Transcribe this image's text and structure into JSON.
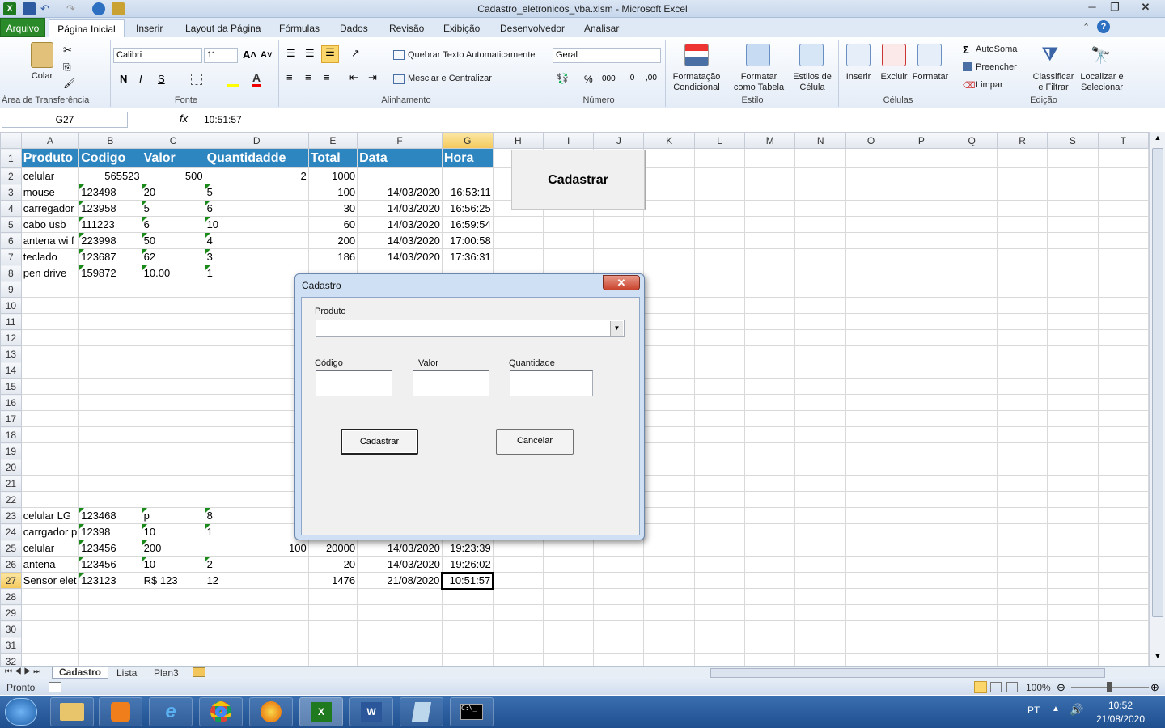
{
  "window": {
    "title": "Cadastro_eletronicos_vba.xlsm - Microsoft Excel"
  },
  "ribbon": {
    "tabs": [
      "Arquivo",
      "Página Inicial",
      "Inserir",
      "Layout da Página",
      "Fórmulas",
      "Dados",
      "Revisão",
      "Exibição",
      "Desenvolvedor",
      "Analisar"
    ],
    "clipboard": {
      "paste": "Colar",
      "group": "Área de Transferência"
    },
    "font": {
      "name": "Calibri",
      "size": "11",
      "group": "Fonte"
    },
    "alignment": {
      "wrap": "Quebrar Texto Automaticamente",
      "merge": "Mesclar e Centralizar",
      "group": "Alinhamento"
    },
    "number": {
      "format": "Geral",
      "group": "Número"
    },
    "styles": {
      "conditional": "Formatação Condicional",
      "table": "Formatar como Tabela",
      "cell": "Estilos de Célula",
      "group": "Estilo"
    },
    "cells": {
      "insert": "Inserir",
      "delete": "Excluir",
      "format": "Formatar",
      "group": "Células"
    },
    "editing": {
      "autosum": "AutoSoma",
      "fill": "Preencher",
      "clear": "Limpar",
      "sort": "Classificar e Filtrar",
      "find": "Localizar e Selecionar",
      "group": "Edição"
    }
  },
  "formula_bar": {
    "name_box": "G27",
    "fx": "fx",
    "value": "10:51:57"
  },
  "sheet": {
    "columns": [
      "A",
      "B",
      "C",
      "D",
      "E",
      "F",
      "G",
      "H",
      "I",
      "J",
      "K",
      "L",
      "M",
      "N",
      "O",
      "P",
      "Q",
      "R",
      "S",
      "T"
    ],
    "header_row": [
      "Produto",
      "Codigo",
      "Valor",
      "Quantidadde",
      "Total",
      "Data",
      "Hora"
    ],
    "rows": [
      {
        "n": "2",
        "a": "celular",
        "b": "565523",
        "c": "500",
        "d": "2",
        "e": "1000",
        "f": "",
        "g": ""
      },
      {
        "n": "3",
        "a": "mouse",
        "b": "123498",
        "c": "20",
        "d": "5",
        "e": "100",
        "f": "14/03/2020",
        "g": "16:53:11"
      },
      {
        "n": "4",
        "a": "carregador",
        "b": "123958",
        "c": "5",
        "d": "6",
        "e": "30",
        "f": "14/03/2020",
        "g": "16:56:25"
      },
      {
        "n": "5",
        "a": "cabo usb",
        "b": "111223",
        "c": "6",
        "d": "10",
        "e": "60",
        "f": "14/03/2020",
        "g": "16:59:54"
      },
      {
        "n": "6",
        "a": "antena wi f",
        "b": "223998",
        "c": "50",
        "d": "4",
        "e": "200",
        "f": "14/03/2020",
        "g": "17:00:58"
      },
      {
        "n": "7",
        "a": "teclado",
        "b": "123687",
        "c": "62",
        "d": "3",
        "e": "186",
        "f": "14/03/2020",
        "g": "17:36:31"
      },
      {
        "n": "8",
        "a": "pen drive",
        "b": "159872",
        "c": "10.00",
        "d": "1",
        "e": "",
        "f": "",
        "g": ""
      },
      {
        "n": "9",
        "a": "",
        "b": "",
        "c": "",
        "d": "",
        "e": "",
        "f": "",
        "g": ""
      },
      {
        "n": "10",
        "a": "",
        "b": "",
        "c": "",
        "d": "",
        "e": "",
        "f": "",
        "g": ""
      },
      {
        "n": "11",
        "a": "",
        "b": "",
        "c": "",
        "d": "",
        "e": "",
        "f": "",
        "g": ""
      },
      {
        "n": "12",
        "a": "",
        "b": "",
        "c": "",
        "d": "",
        "e": "",
        "f": "",
        "g": ""
      },
      {
        "n": "13",
        "a": "",
        "b": "",
        "c": "",
        "d": "",
        "e": "",
        "f": "",
        "g": ""
      },
      {
        "n": "14",
        "a": "",
        "b": "",
        "c": "",
        "d": "",
        "e": "",
        "f": "",
        "g": ""
      },
      {
        "n": "15",
        "a": "",
        "b": "",
        "c": "",
        "d": "",
        "e": "",
        "f": "",
        "g": ""
      },
      {
        "n": "16",
        "a": "",
        "b": "",
        "c": "",
        "d": "",
        "e": "",
        "f": "",
        "g": ""
      },
      {
        "n": "17",
        "a": "",
        "b": "",
        "c": "",
        "d": "",
        "e": "",
        "f": "",
        "g": ""
      },
      {
        "n": "18",
        "a": "",
        "b": "",
        "c": "",
        "d": "",
        "e": "",
        "f": "",
        "g": ""
      },
      {
        "n": "19",
        "a": "",
        "b": "",
        "c": "",
        "d": "",
        "e": "",
        "f": "",
        "g": ""
      },
      {
        "n": "20",
        "a": "",
        "b": "",
        "c": "",
        "d": "",
        "e": "",
        "f": "",
        "g": ""
      },
      {
        "n": "21",
        "a": "",
        "b": "",
        "c": "",
        "d": "",
        "e": "",
        "f": "",
        "g": ""
      },
      {
        "n": "22",
        "a": "",
        "b": "",
        "c": "",
        "d": "",
        "e": "",
        "f": "",
        "g": ""
      },
      {
        "n": "23",
        "a": "celular LG",
        "b": "123468",
        "c": "p",
        "d": "8",
        "e": "",
        "f": "",
        "g": ""
      },
      {
        "n": "24",
        "a": "carrgador p",
        "b": "12398",
        "c": "10",
        "d": "1",
        "e": "",
        "f": "",
        "g": ""
      },
      {
        "n": "25",
        "a": "celular",
        "b": "123456",
        "c": "200",
        "d": "100",
        "e": "20000",
        "f": "14/03/2020",
        "g": "19:23:39"
      },
      {
        "n": "26",
        "a": "antena",
        "b": "123456",
        "c": "10",
        "d": "2",
        "e": "20",
        "f": "14/03/2020",
        "g": "19:26:02"
      },
      {
        "n": "27",
        "a": "Sensor elet",
        "b": "123123",
        "c": "R$ 123",
        "d": "12",
        "e": "1476",
        "f": "21/08/2020",
        "g": "10:51:57"
      },
      {
        "n": "28",
        "a": "",
        "b": "",
        "c": "",
        "d": "",
        "e": "",
        "f": "",
        "g": ""
      },
      {
        "n": "29",
        "a": "",
        "b": "",
        "c": "",
        "d": "",
        "e": "",
        "f": "",
        "g": ""
      },
      {
        "n": "30",
        "a": "",
        "b": "",
        "c": "",
        "d": "",
        "e": "",
        "f": "",
        "g": ""
      },
      {
        "n": "31",
        "a": "",
        "b": "",
        "c": "",
        "d": "",
        "e": "",
        "f": "",
        "g": ""
      },
      {
        "n": "32",
        "a": "",
        "b": "",
        "c": "",
        "d": "",
        "e": "",
        "f": "",
        "g": ""
      }
    ],
    "button_label": "Cadastrar",
    "tabs": [
      "Cadastro",
      "Lista",
      "Plan3"
    ]
  },
  "dialog": {
    "title": "Cadastro",
    "close": "✕",
    "produto_label": "Produto",
    "codigo_label": "Código",
    "valor_label": "Valor",
    "quantidade_label": "Quantidade",
    "ok": "Cadastrar",
    "cancel": "Cancelar"
  },
  "status": {
    "ready": "Pronto",
    "zoom": "100%"
  },
  "taskbar": {
    "lang": "PT",
    "time": "10:52",
    "date": "21/08/2020"
  }
}
